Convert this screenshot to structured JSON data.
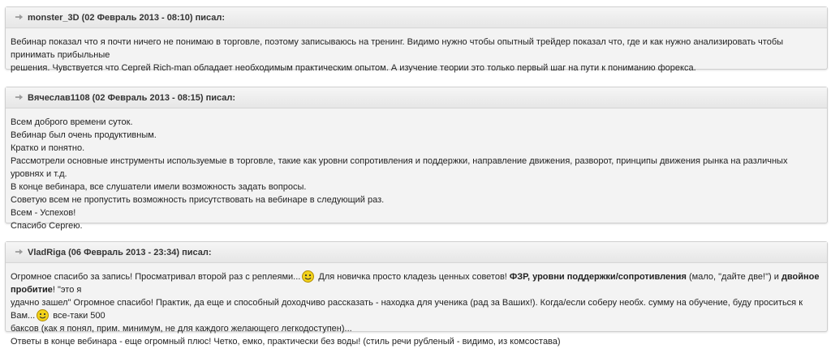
{
  "posts": [
    {
      "header": "monster_3D (02 Февраль 2013 - 08:10) писал:",
      "lines": [
        "Вебинар показал что я почти ничего не понимаю в торговле, поэтому записываюсь на тренинг. Видимо нужно чтобы опытный трейдер показал что, где и как нужно анализировать чтобы принимать прибыльные",
        "решения. Чувствуется что Сергей Rich-man обладает необходимым практическим опытом. А изучение теории это только первый шаг на пути к пониманию форекса."
      ]
    },
    {
      "header": "Вячеслав1108 (02 Февраль 2013 - 08:15) писал:",
      "lines": [
        "Всем доброго времени суток.",
        "Вебинар был очень продуктивным.",
        "Кратко и понятно.",
        "Рассмотрели основные инструменты используемые в торговле, такие как уровни сопротивления и поддержки, направление движения, разворот, принципы движения рынка на различных уровнях и т.д.",
        "В конце вебинара, все слушатели имели возможность задать вопросы.",
        "Советую всем не пропустить возможность присутствовать на вебинаре в следующий раз.",
        "Всем - Успехов!",
        "Спасибо Сергею."
      ]
    },
    {
      "header": "VladRiga (06 Февраль 2013 - 23:34) писал:",
      "segments": {
        "s1": "Огромное спасибо за запись! Просматривал второй раз с реплеями...",
        "s2": " Для новичка просто кладезь ценных советов! ",
        "b1": "ФЗР, уровни поддержки/сопротивления",
        "s3": " (мало, \"дайте две!\") и ",
        "b2": "двойное пробитие",
        "s4": "! \"это я",
        "s5": "удачно зашел\" Огромное спасибо! Практик, да еще и способный доходчиво рассказать - находка для ученика (рад за Ваших!). Когда/если соберу необх. сумму на обучение, буду проситься к Вам...",
        "s6": " все-таки 500",
        "s7": "баксов (как я понял, прим. минимум, не для каждого желающего легкодоступен)...",
        "s8": "Ответы в конце вебинара - еще огромный плюс! Четко, емко, практически без воды! (стиль речи рубленый - видимо, из комсостава)"
      }
    }
  ],
  "icons": {
    "quote": "quote-arrow-icon",
    "smile": "smiley-icon"
  },
  "colors": {
    "panel": "#f3f3f3",
    "border": "#cfcfcf",
    "smiley": "#f2d21b"
  }
}
